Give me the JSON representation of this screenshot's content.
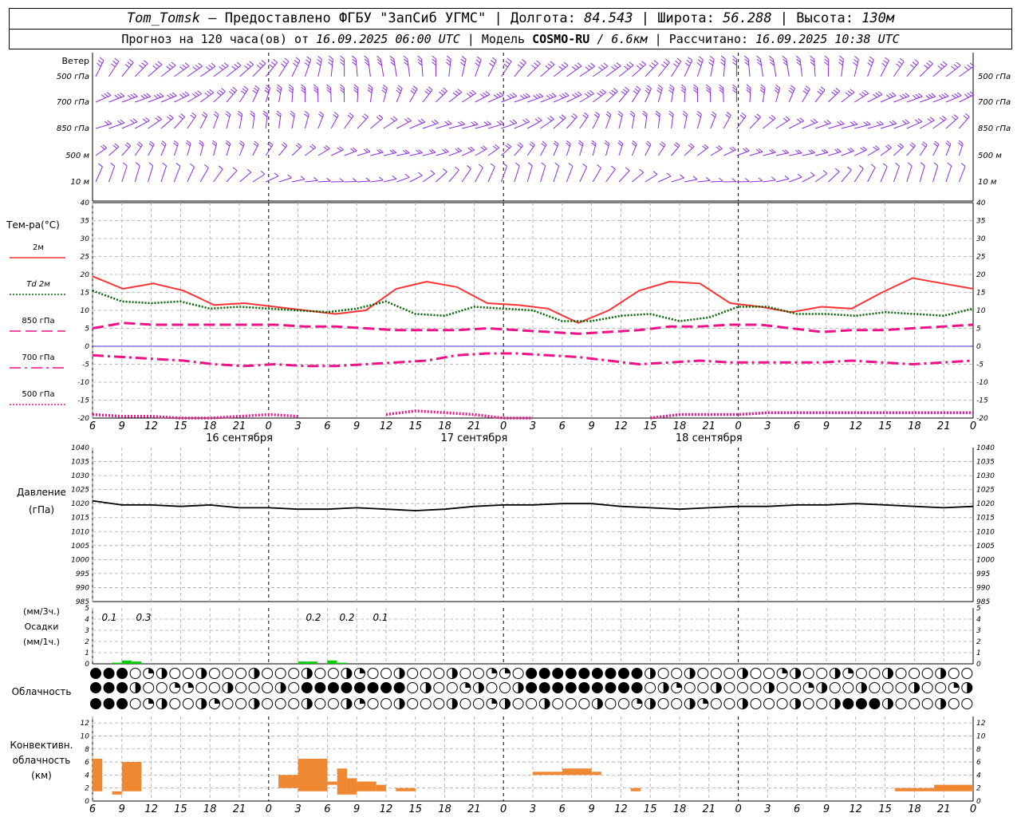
{
  "header": {
    "station": "Tom_Tomsk",
    "provider": "– Предоставлено ФГБУ \"ЗапСиб УГМС\"",
    "lon_label": "Долгота:",
    "lon": "84.543",
    "lat_label": "Широта:",
    "lat": "56.288",
    "alt_label": "Высота:",
    "alt": "130м",
    "forecast_label": "Прогноз на 120 часа(ов) от",
    "forecast_start": "16.09.2025 06:00 UTC",
    "model_label": "Модель",
    "model": "COSMO-RU",
    "resolution": "/ 6.6км",
    "calc_label": "Рассчитано:",
    "calc_time": "16.09.2025 10:38 UTC"
  },
  "labels": {
    "wind": "Ветер",
    "wind_levels": [
      "500 гПа",
      "700 гПа",
      "850 гПа",
      "500 м",
      "10  м"
    ],
    "temp_title": "Тем-ра(°С)",
    "temp_series": [
      "2м",
      "Td  2м",
      "850 гПа",
      "700 гПа",
      "500 гПа"
    ],
    "pressure_title": "Давление",
    "pressure_unit": "(гПа)",
    "precip_unit_3h": "(мм/3ч.)",
    "precip_title": "Осадки",
    "precip_unit_1h": "(мм/1ч.)",
    "cloud_title": "Облачность",
    "conv_title": [
      "Конвективн.",
      "облачность",
      "(км)"
    ],
    "dates": [
      "16 сентября",
      "17 сентября",
      "18 сентября"
    ]
  },
  "colors": {
    "wind": "#8a2be2",
    "t2m": "#ff3333",
    "td2m": "#006400",
    "t850": "#ee1188",
    "t700": "#ee1188",
    "t500": "#ee1188",
    "pressure": "#000000",
    "precip": "#00cc00",
    "conv": "#ee8833",
    "grid": "#aaaaaa"
  },
  "chart_data": [
    {
      "type": "line",
      "title": "Тем-ра(°С)",
      "x_ticks": [
        "6",
        "9",
        "12",
        "15",
        "18",
        "21",
        "0",
        "3",
        "6",
        "9",
        "12",
        "15",
        "18",
        "21",
        "0",
        "3",
        "6",
        "9",
        "12",
        "15",
        "18",
        "21",
        "0",
        "3",
        "6",
        "9",
        "12"
      ],
      "ylim": [
        -20,
        40
      ],
      "y_ticks": [
        -20,
        -15,
        -10,
        -5,
        0,
        5,
        10,
        15,
        20,
        25,
        30,
        35,
        40
      ],
      "x_hours": [
        0,
        3,
        6,
        9,
        12,
        15,
        18,
        21,
        24,
        27,
        30,
        33,
        36,
        39,
        42,
        45,
        48,
        51,
        54,
        57,
        60,
        63,
        66,
        69,
        72,
        75,
        78
      ],
      "series": [
        {
          "name": "2м",
          "style": "solid",
          "values": [
            19.5,
            16,
            17.5,
            15.5,
            11.5,
            12,
            11,
            10,
            9,
            10,
            16,
            18,
            16.5,
            12,
            11.5,
            10.5,
            6.5,
            10,
            15.5,
            18,
            17.5,
            12,
            11,
            9.5,
            11,
            10.5,
            15,
            19,
            17.5,
            16
          ]
        },
        {
          "name": "Td  2м",
          "style": "dotted",
          "values": [
            15.5,
            12.5,
            12,
            12.5,
            10.5,
            11,
            10.5,
            10,
            9.5,
            10.5,
            12.5,
            9,
            8.5,
            11,
            10.5,
            10,
            7,
            7,
            8.5,
            9,
            7,
            8,
            11,
            11,
            9,
            9,
            8.5,
            9.5,
            9,
            8.5,
            10.5
          ]
        },
        {
          "name": "850 гПа",
          "style": "dash",
          "values": [
            5,
            6.5,
            6,
            6,
            6,
            6,
            6,
            5.5,
            5.5,
            5,
            4.5,
            4.5,
            4.5,
            5,
            4.5,
            4,
            3.5,
            4,
            4.5,
            5.5,
            5.5,
            6,
            6,
            5,
            4,
            4.5,
            4.5,
            5,
            5.5,
            6
          ]
        },
        {
          "name": "700 гПа",
          "style": "dashdot",
          "values": [
            -2.5,
            -3,
            -3.5,
            -4,
            -5,
            -5.5,
            -5,
            -5.5,
            -5.5,
            -5,
            -4.5,
            -4,
            -2.5,
            -2,
            -2,
            -2.5,
            -3,
            -4,
            -5,
            -4.5,
            -4,
            -4.5,
            -4.5,
            -4.5,
            -4.5,
            -4,
            -4.5,
            -5,
            -4.5,
            -4
          ]
        },
        {
          "name": "500 гПа",
          "style": "dotted",
          "values": [
            -19,
            -19.5,
            -19.5,
            -20,
            -20,
            -19.5,
            -19,
            -19.5,
            null,
            null,
            -19,
            -18,
            -18.5,
            -19,
            -20,
            -20,
            null,
            null,
            null,
            -20,
            -19,
            -19,
            -19,
            -18.5,
            -18.5,
            -18.5,
            -18.5,
            -18.5,
            -18.5,
            -18.5,
            -18.5
          ]
        }
      ]
    },
    {
      "type": "line",
      "title": "Давление",
      "ylim": [
        985,
        1040
      ],
      "y_ticks": [
        985,
        990,
        995,
        1000,
        1005,
        1010,
        1015,
        1020,
        1025,
        1030,
        1035,
        1040
      ],
      "series": [
        {
          "name": "Давление",
          "values": [
            1021,
            1019.5,
            1019.5,
            1019,
            1019.5,
            1018.5,
            1018.5,
            1018,
            1018,
            1018.5,
            1018,
            1017.5,
            1018,
            1019,
            1019.5,
            1019.5,
            1020,
            1020,
            1019,
            1018.5,
            1018,
            1018.5,
            1019,
            1019,
            1019.5,
            1019.5,
            1020,
            1019.5,
            1019,
            1018.5,
            1019
          ]
        }
      ]
    },
    {
      "type": "bar",
      "title": "Осадки",
      "ylim": [
        0,
        5
      ],
      "annotations_3h": [
        {
          "x": "9",
          "text": "0.1"
        },
        {
          "x": "12",
          "text": "0.3"
        },
        {
          "x": "3",
          "text": "0.2"
        },
        {
          "x": "6",
          "text": "0.2"
        },
        {
          "x": "9",
          "text": "0.1"
        }
      ],
      "bars": [
        {
          "hour": 2,
          "value": 0.1
        },
        {
          "hour": 3,
          "value": 0.3
        },
        {
          "hour": 4,
          "value": 0.2
        },
        {
          "hour": 21,
          "value": 0.2
        },
        {
          "hour": 22,
          "value": 0.2
        },
        {
          "hour": 24,
          "value": 0.3
        },
        {
          "hour": 25,
          "value": 0.1
        }
      ]
    },
    {
      "type": "bar",
      "title": "Конвективн. облачность (км)",
      "ylim": [
        0,
        13
      ],
      "y_ticks": [
        0,
        2,
        4,
        6,
        8,
        10,
        12
      ],
      "boxes": [
        {
          "h0": 0,
          "h1": 1,
          "bottom": 1.5,
          "top": 6.5
        },
        {
          "h0": 2,
          "h1": 3,
          "bottom": 1,
          "top": 1.5
        },
        {
          "h0": 3,
          "h1": 5,
          "bottom": 1.5,
          "top": 6
        },
        {
          "h0": 19,
          "h1": 21,
          "bottom": 2,
          "top": 4
        },
        {
          "h0": 21,
          "h1": 24,
          "bottom": 1.5,
          "top": 6.5
        },
        {
          "h0": 24,
          "h1": 25,
          "bottom": 2.5,
          "top": 3
        },
        {
          "h0": 25,
          "h1": 26,
          "bottom": 1,
          "top": 5
        },
        {
          "h0": 26,
          "h1": 27,
          "bottom": 1,
          "top": 3.5
        },
        {
          "h0": 27,
          "h1": 29,
          "bottom": 1.5,
          "top": 3
        },
        {
          "h0": 29,
          "h1": 30,
          "bottom": 1.5,
          "top": 2.5
        },
        {
          "h0": 31,
          "h1": 33,
          "bottom": 1.5,
          "top": 2
        },
        {
          "h0": 45,
          "h1": 48,
          "bottom": 4,
          "top": 4.5
        },
        {
          "h0": 48,
          "h1": 51,
          "bottom": 4,
          "top": 5
        },
        {
          "h0": 51,
          "h1": 52,
          "bottom": 4,
          "top": 4.5
        },
        {
          "h0": 55,
          "h1": 56,
          "bottom": 1.5,
          "top": 2
        },
        {
          "h0": 82,
          "h1": 86,
          "bottom": 1.5,
          "top": 2
        },
        {
          "h0": 86,
          "h1": 88,
          "bottom": 1.5,
          "top": 2.5
        },
        {
          "h0": 88,
          "h1": 90,
          "bottom": 1.5,
          "top": 2.5
        }
      ]
    }
  ]
}
